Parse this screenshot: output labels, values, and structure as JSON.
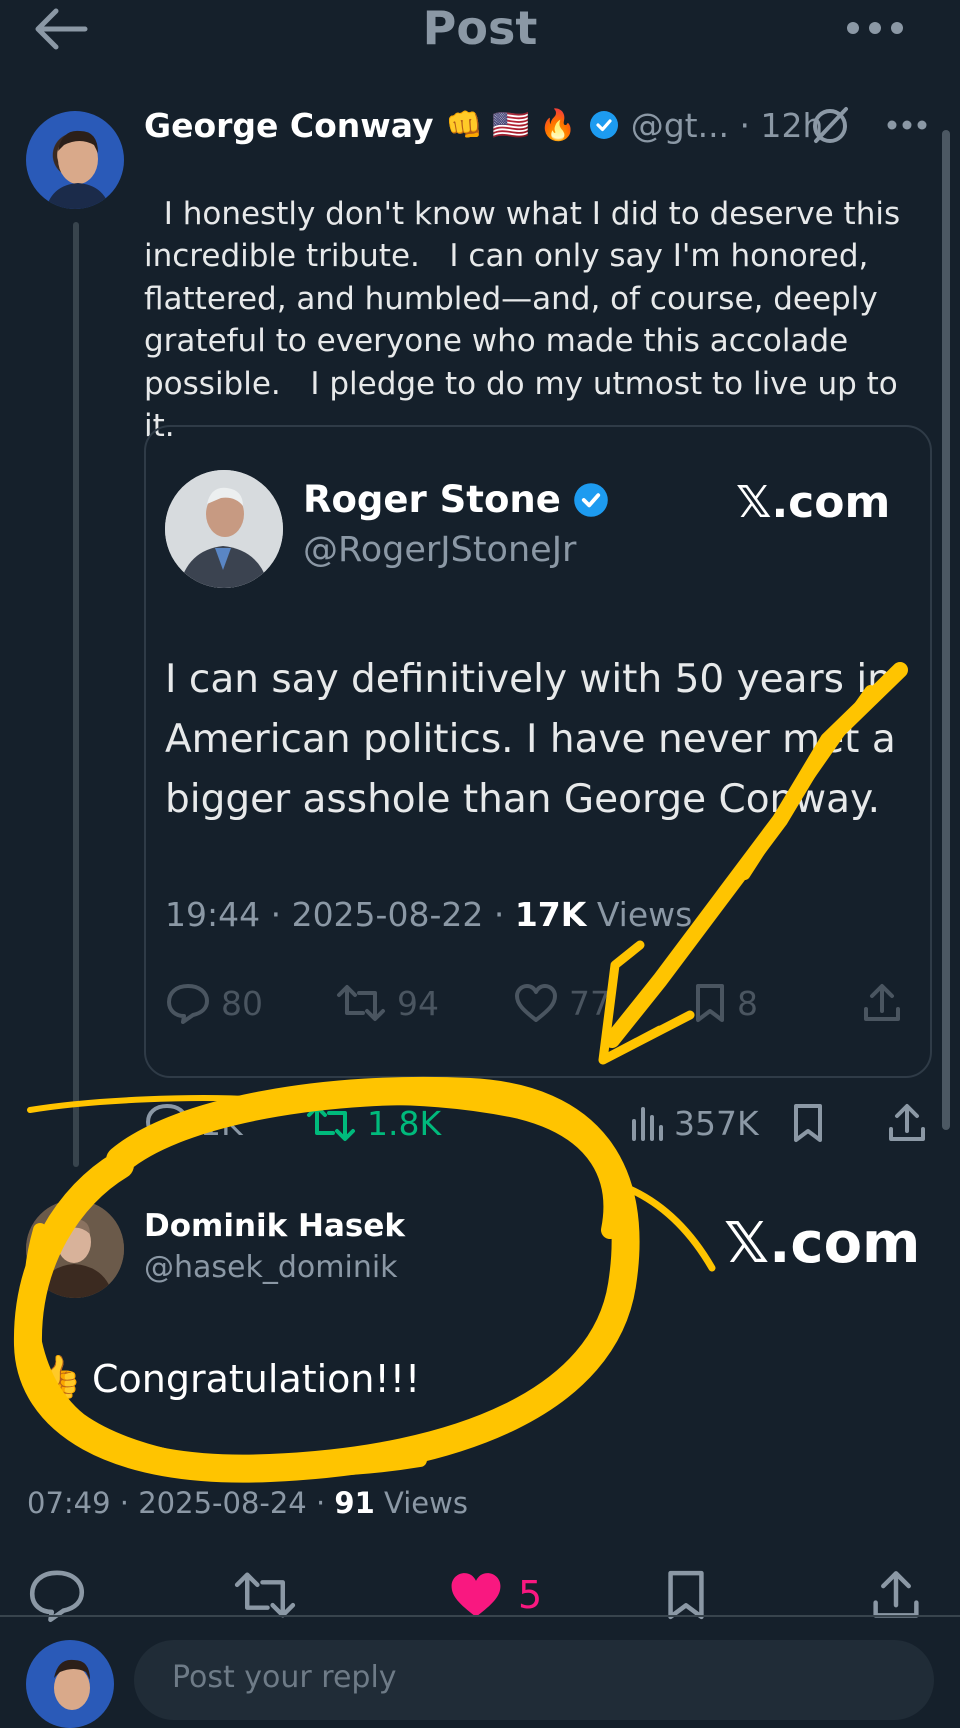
{
  "header": {
    "title": "Post",
    "back_icon": "arrow-left-icon",
    "more_icon": "more-horizontal-icon"
  },
  "post": {
    "author_name": "George Conway",
    "author_emojis": "👊 🇺🇸 🔥",
    "handle_time": "@gt... · 12h",
    "text": "I honestly don't know what I did to deserve this incredible tribute.   I can only say I'm honored, flattered, and humbled—and, of course, deeply grateful to everyone who made this accolade possible.   I pledge to do my utmost to live up to it.",
    "text_emojis": "🙏🏼🤗"
  },
  "quote": {
    "author_name": "Roger Stone",
    "handle": "@RogerJStoneJr",
    "watermark": "𝕏.com",
    "text": "I can say definitively with 50 years in American politics. I have never met a bigger asshole than George Conway.",
    "time_date": "19:44 · 2025-08-22 · ",
    "views_count": "17K",
    "views_label": "Views",
    "replies": "80",
    "reposts": "94",
    "likes": "77",
    "bookmarks": "8"
  },
  "metrics": {
    "replies": "1K",
    "reposts": "1.8K",
    "views": "357K"
  },
  "reply": {
    "author_name": "Dominik Hasek",
    "handle": "@hasek_dominik",
    "watermark": "𝕏.com",
    "emoji": "👍",
    "text": "Congratulation!!!",
    "time_date": "07:49 · 2025-08-24 · ",
    "views_count": "91",
    "views_label": "Views",
    "likes": "5"
  },
  "composer": {
    "placeholder": "Post your reply"
  },
  "colors": {
    "background": "#15202b",
    "accent_blue": "#1d9bf0",
    "like_pink": "#f91880",
    "repost_green": "#00ba7c",
    "highlight_yellow": "#ffc400"
  }
}
